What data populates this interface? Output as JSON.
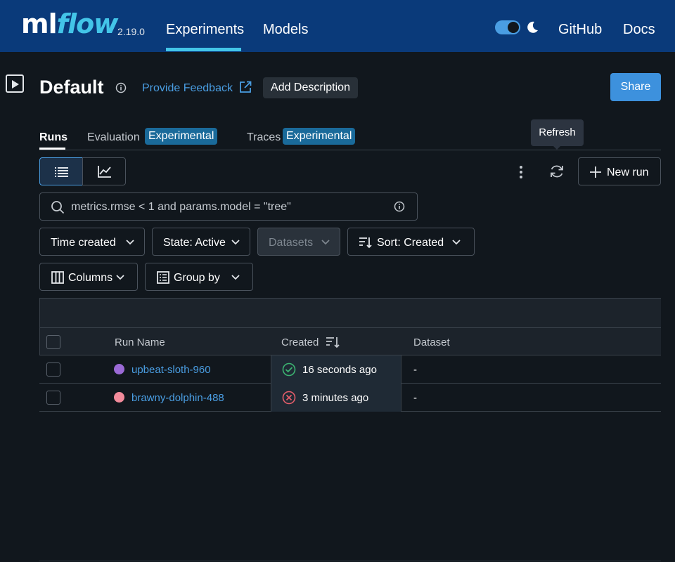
{
  "header": {
    "logo_ml": "ml",
    "logo_flow": "flow",
    "version": "2.19.0",
    "nav": {
      "experiments": "Experiments",
      "models": "Models",
      "github": "GitHub",
      "docs": "Docs"
    },
    "theme_toggle_on": true
  },
  "experiment": {
    "title": "Default",
    "feedback_label": "Provide Feedback",
    "add_description_label": "Add Description",
    "share_label": "Share"
  },
  "tooltip": {
    "text": "Refresh"
  },
  "tabs": [
    {
      "label": "Runs",
      "active": true
    },
    {
      "label": "Evaluation",
      "badge": "Experimental"
    },
    {
      "label": "Traces",
      "badge": "Experimental"
    }
  ],
  "toolbar": {
    "new_run_label": "New run"
  },
  "search": {
    "value": "metrics.rmse < 1 and params.model = \"tree\""
  },
  "filters": {
    "time_created": "Time created",
    "state": "State: Active",
    "datasets": "Datasets",
    "sort": "Sort: Created",
    "columns": "Columns",
    "group_by": "Group by"
  },
  "table": {
    "columns": [
      "Run Name",
      "Created",
      "Dataset"
    ],
    "rows": [
      {
        "name": "upbeat-sloth-960",
        "color": "#9b6ad6",
        "created": "16 seconds ago",
        "status": "success",
        "dataset": "-"
      },
      {
        "name": "brawny-dolphin-488",
        "color": "#f28b9b",
        "created": "3 minutes ago",
        "status": "failed",
        "dataset": "-"
      }
    ]
  },
  "colors": {
    "header_bg": "#0a3a7a",
    "accent": "#43c5e8",
    "link": "#4a9ee3",
    "success": "#3cb371",
    "error": "#e35d6a"
  }
}
